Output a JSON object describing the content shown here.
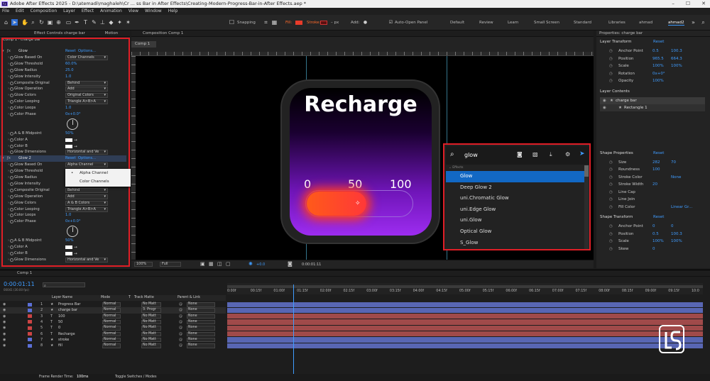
{
  "window": {
    "title": "Adobe After Effects 2025 - D:\\atemadi\\maghaleh\\Cr ... ss Bar in After Effects\\Creating-Modern-Progress-Bar-in-After Effects.aep *",
    "min": "–",
    "max": "☐",
    "close": "✕",
    "app_badge": "Ae"
  },
  "menu": [
    "File",
    "Edit",
    "Composition",
    "Layer",
    "Effect",
    "Animation",
    "View",
    "Window",
    "Help"
  ],
  "toolbar": {
    "snapping": "Snapping",
    "fill": "Fill:",
    "stroke": "Stroke:",
    "stroke_px": "– px",
    "add": "Add:",
    "auto_open": "Auto-Open Panel",
    "workspaces": [
      "Default",
      "Review",
      "Learn",
      "Small Screen",
      "Standard",
      "Libraries",
      "ahmad",
      "ahmad2"
    ]
  },
  "effects_panel": {
    "tab": "Effect Controls charge bar",
    "motion_tab": "Motion",
    "header": "Comp 1 · charge bar",
    "glow1": {
      "name": "Glow",
      "reset": "Reset",
      "options": "Options...",
      "rows": [
        {
          "l": "Glow Based On",
          "dd": "Color Channels"
        },
        {
          "l": "Glow Threshold",
          "v": "60.0%"
        },
        {
          "l": "Glow Radius",
          "v": "25.0"
        },
        {
          "l": "Glow Intensity",
          "v": "1.0"
        },
        {
          "l": "Composite Original",
          "dd": "Behind"
        },
        {
          "l": "Glow Operation",
          "dd": "Add"
        },
        {
          "l": "Glow Colors",
          "dd": "Original Colors"
        },
        {
          "l": "Color Looping",
          "dd": "Triangle A>B>A"
        },
        {
          "l": "Color Loops",
          "v": "1.0"
        },
        {
          "l": "Color Phase",
          "v": "0x+0.0°"
        },
        {
          "l": "A & B Midpoint",
          "v": "50%"
        },
        {
          "l": "Color A"
        },
        {
          "l": "Color B"
        },
        {
          "l": "Glow Dimensions",
          "dd": "Horizontal and Ve"
        }
      ]
    },
    "glow2": {
      "name": "Glow 2",
      "reset": "Reset",
      "options": "Options...",
      "rows": [
        {
          "l": "Glow Based On",
          "dd": "Alpha Channel"
        },
        {
          "l": "Glow Threshold"
        },
        {
          "l": "Glow Radius"
        },
        {
          "l": "Glow Intensity"
        },
        {
          "l": "Composite Original",
          "dd": "Behind"
        },
        {
          "l": "Glow Operation",
          "dd": "Add"
        },
        {
          "l": "Glow Colors",
          "dd": "A & B Colors"
        },
        {
          "l": "Color Looping",
          "dd": "Triangle A>B>A"
        },
        {
          "l": "Color Loops",
          "v": "1.0"
        },
        {
          "l": "Color Phase",
          "v": "0x+0.0°"
        },
        {
          "l": "A & B Midpoint",
          "v": "50%"
        },
        {
          "l": "Color A"
        },
        {
          "l": "Color B"
        },
        {
          "l": "Glow Dimensions",
          "dd": "Horizontal and Ve"
        }
      ]
    },
    "popup": [
      "Alpha Channel",
      "Color Channels"
    ]
  },
  "comp_panel": {
    "tab": "Composition Comp 1",
    "subtab": "Comp 1",
    "zoom": "100%",
    "quality": "Full",
    "exposure": "+0.0",
    "timecode": "0:00:01:11"
  },
  "artwork": {
    "title": "Recharge",
    "ticks": [
      "0",
      "50",
      "100"
    ]
  },
  "search": {
    "query": "glow",
    "category": "Effects",
    "results": [
      "Glow",
      "Deep Glow 2",
      "uni.Chromatic Glow",
      "uni.Edge Glow",
      "uni.Glow",
      "Optical Glow",
      "S_Glow"
    ]
  },
  "properties": {
    "title": "Properties: charge bar",
    "layer_transform": {
      "h": "Layer Transform",
      "reset": "Reset",
      "rows": [
        {
          "l": "Anchor Point",
          "a": "0.5",
          "b": "100.3"
        },
        {
          "l": "Position",
          "a": "965.5",
          "b": "664.3"
        },
        {
          "l": "Scale",
          "a": "100%",
          "b": "100%"
        },
        {
          "l": "Rotation",
          "a": "0x+0°"
        },
        {
          "l": "Opacity",
          "a": "100%"
        }
      ]
    },
    "layer_contents": {
      "h": "Layer Contents",
      "items": [
        "charge bar",
        "Rectangle 1"
      ]
    },
    "shape_props": {
      "h": "Shape Properties",
      "reset": "Reset",
      "rows": [
        {
          "l": "Size",
          "a": "282",
          "b": "70"
        },
        {
          "l": "Roundness",
          "a": "100"
        },
        {
          "l": "Stroke Color",
          "b": "None"
        },
        {
          "l": "Stroke Width",
          "a": "20"
        },
        {
          "l": "Line Cap"
        },
        {
          "l": "Line Join"
        },
        {
          "l": "Fill Color",
          "b": "Linear Gr..."
        }
      ]
    },
    "shape_transform": {
      "h": "Shape Transform",
      "reset": "Reset",
      "rows": [
        {
          "l": "Anchor Point",
          "a": "0",
          "b": "0"
        },
        {
          "l": "Position",
          "a": "0.5",
          "b": "100.3"
        },
        {
          "l": "Scale",
          "a": "100%",
          "b": "100%"
        },
        {
          "l": "Skew",
          "a": "0"
        }
      ]
    }
  },
  "timeline": {
    "tab": "Comp 1",
    "timecode": "0:00:01:11",
    "fps": "00041 (30.00 fps)",
    "headers": {
      "layer_name": "Layer Name",
      "mode": "Mode",
      "t": "T",
      "track_matte": "Track Matte",
      "parent": "Parent & Link"
    },
    "layers": [
      {
        "n": "1",
        "name": "Progress Bar",
        "mode": "Normal",
        "tm": "No Matt",
        "parent": "None",
        "color": "#5b6fd6"
      },
      {
        "n": "2",
        "name": "charge bar",
        "mode": "Normal",
        "tm": "3. Progr",
        "parent": "None",
        "color": "#5b6fd6"
      },
      {
        "n": "3",
        "name": "100",
        "mode": "Normal",
        "tm": "No Matt",
        "parent": "None",
        "color": "#c44"
      },
      {
        "n": "4",
        "name": "50",
        "mode": "Normal",
        "tm": "No Matt",
        "parent": "None",
        "color": "#c44"
      },
      {
        "n": "5",
        "name": "0",
        "mode": "Normal",
        "tm": "No Matt",
        "parent": "None",
        "color": "#c44"
      },
      {
        "n": "6",
        "name": "Recharge",
        "mode": "Normal",
        "tm": "No Matt",
        "parent": "None",
        "color": "#c44"
      },
      {
        "n": "7",
        "name": "stroke",
        "mode": "Normal",
        "tm": "No Matt",
        "parent": "None",
        "color": "#5b6fd6"
      },
      {
        "n": "8",
        "name": "fill",
        "mode": "Normal",
        "tm": "No Matt",
        "parent": "None",
        "color": "#5b6fd6"
      }
    ],
    "ruler": [
      "0:00f",
      "00:15f",
      "01:00f",
      "01:15f",
      "02:00f",
      "02:15f",
      "03:00f",
      "03:15f",
      "04:00f",
      "04:15f",
      "05:00f",
      "05:15f",
      "06:00f",
      "06:15f",
      "07:00f",
      "07:15f",
      "08:00f",
      "08:15f",
      "09:00f",
      "09:15f",
      "10:0"
    ],
    "render_time_label": "Frame Render Time:",
    "render_time": "100ms",
    "toggle": "Toggle Switches / Modes"
  },
  "colors": {
    "accent": "#3f9cff",
    "highlight": "#e01e26",
    "select": "#1268c4"
  }
}
